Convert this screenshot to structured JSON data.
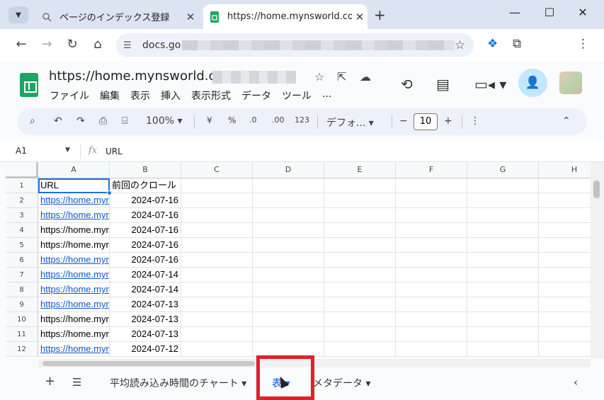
{
  "browser": {
    "tabs": [
      {
        "title": "ページのインデックス登録",
        "active": false
      },
      {
        "title": "https://home.mynsworld.com/-",
        "active": true
      }
    ],
    "address": "docs.go",
    "icons": {
      "back": "arrow-left-icon",
      "forward": "arrow-right-icon",
      "reload": "reload-icon",
      "home": "home-icon"
    }
  },
  "docs": {
    "title": "https://home.mynsworld.com",
    "menu": [
      "ファイル",
      "編集",
      "表示",
      "挿入",
      "表示形式",
      "データ",
      "ツール",
      "..."
    ]
  },
  "format_toolbar": {
    "zoom": "100%",
    "currency": "¥",
    "percent": "%",
    "dec_decrease": ".0",
    "dec_increase": ".00",
    "number_format": "123",
    "font": "デフォ...",
    "font_size": "10"
  },
  "formula_bar": {
    "cell_ref": "A1",
    "fx": "fx",
    "value": "URL"
  },
  "grid": {
    "columns": [
      "A",
      "B",
      "C",
      "D",
      "E",
      "F",
      "G",
      "H"
    ],
    "rows": [
      "1",
      "2",
      "3",
      "4",
      "5",
      "6",
      "7",
      "8",
      "9",
      "10",
      "11",
      "12"
    ],
    "cells": [
      {
        "a": "URL",
        "b": "前回のクロール",
        "link": false
      },
      {
        "a": "https://home.myr",
        "b": "2024-07-16",
        "link": true
      },
      {
        "a": "https://home.myr",
        "b": "2024-07-16",
        "link": true
      },
      {
        "a": "https://home.myr",
        "b": "2024-07-16",
        "link": false
      },
      {
        "a": "https://home.myr",
        "b": "2024-07-16",
        "link": false
      },
      {
        "a": "https://home.myr",
        "b": "2024-07-16",
        "link": true
      },
      {
        "a": "https://home.myr",
        "b": "2024-07-14",
        "link": true
      },
      {
        "a": "https://home.myr",
        "b": "2024-07-14",
        "link": true
      },
      {
        "a": "https://home.myr",
        "b": "2024-07-13",
        "link": true
      },
      {
        "a": "https://home.myr",
        "b": "2024-07-13",
        "link": false
      },
      {
        "a": "https://home.myr",
        "b": "2024-07-13",
        "link": false
      },
      {
        "a": "https://home.myr",
        "b": "2024-07-12",
        "link": true
      }
    ]
  },
  "sheet_tabs": [
    {
      "label": "平均読み込み時間のチャート",
      "active": false
    },
    {
      "label": "表",
      "active": true
    },
    {
      "label": "メタデータ",
      "active": false
    }
  ],
  "colors": {
    "accent": "#1a73e8",
    "sheets_green": "#1fa463",
    "highlight_red": "#e0202a",
    "link": "#1155cc"
  }
}
